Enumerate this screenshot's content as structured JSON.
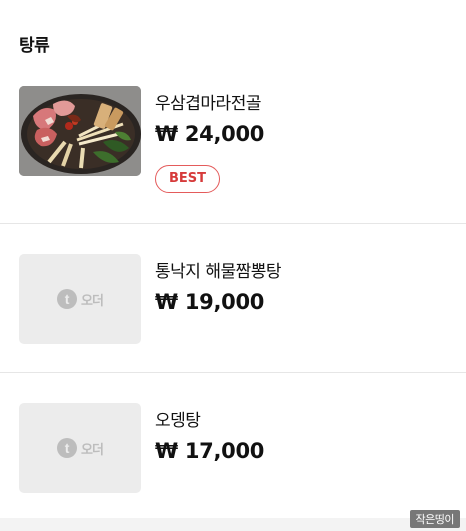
{
  "section": {
    "title": "탕류"
  },
  "items": [
    {
      "name": "우삼겹마라전골",
      "price": "₩ 24,000",
      "badge": "BEST",
      "image": "food-photo"
    },
    {
      "name": "통낙지 해물짬뽕탕",
      "price": "₩ 19,000",
      "image": "placeholder",
      "placeholder_text": "오더"
    },
    {
      "name": "오뎅탕",
      "price": "₩ 17,000",
      "image": "placeholder",
      "placeholder_text": "오더"
    }
  ],
  "watermark": "작은띵이"
}
